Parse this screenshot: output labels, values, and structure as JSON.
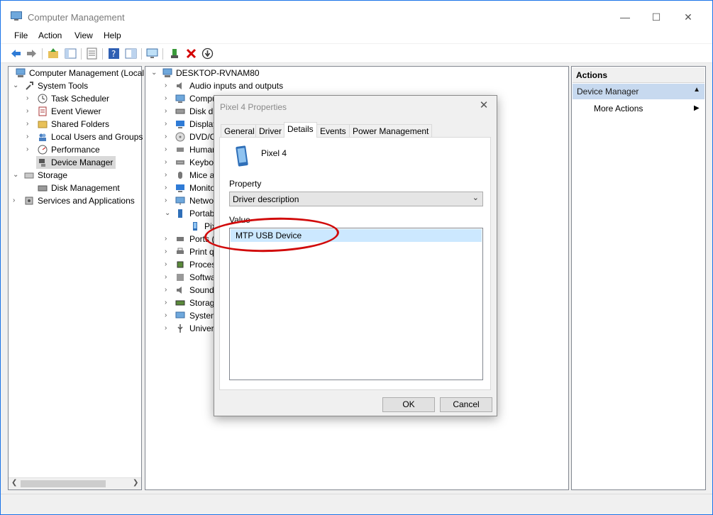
{
  "window": {
    "title": "Computer Management"
  },
  "menu": [
    "File",
    "Action",
    "View",
    "Help"
  ],
  "left_tree": [
    {
      "label": "Computer Management (Local",
      "level": 0,
      "icon": "computer-management-icon",
      "chev": ""
    },
    {
      "label": "System Tools",
      "level": 1,
      "icon": "tools-icon",
      "chev": "⌄"
    },
    {
      "label": "Task Scheduler",
      "level": 2,
      "icon": "clock-icon",
      "chev": "›"
    },
    {
      "label": "Event Viewer",
      "level": 2,
      "icon": "event-viewer-icon",
      "chev": "›"
    },
    {
      "label": "Shared Folders",
      "level": 2,
      "icon": "folder-icon",
      "chev": "›"
    },
    {
      "label": "Local Users and Groups",
      "level": 2,
      "icon": "users-icon",
      "chev": "›"
    },
    {
      "label": "Performance",
      "level": 2,
      "icon": "performance-icon",
      "chev": "›"
    },
    {
      "label": "Device Manager",
      "level": 2,
      "icon": "device-manager-icon",
      "chev": "",
      "selected": true
    },
    {
      "label": "Storage",
      "level": 1,
      "icon": "storage-icon",
      "chev": "⌄"
    },
    {
      "label": "Disk Management",
      "level": 2,
      "icon": "disk-icon",
      "chev": ""
    },
    {
      "label": "Services and Applications",
      "level": 1,
      "icon": "services-icon",
      "chev": "›"
    }
  ],
  "device_tree": {
    "root": "DESKTOP-RVNAM80",
    "items": [
      {
        "label": "Audio inputs and outputs",
        "icon": "speaker-icon",
        "chev": "›"
      },
      {
        "label": "Compu",
        "icon": "computer-icon",
        "chev": "›"
      },
      {
        "label": "Disk dr",
        "icon": "disk-drive-icon",
        "chev": "›"
      },
      {
        "label": "Display",
        "icon": "display-icon",
        "chev": "›"
      },
      {
        "label": "DVD/C",
        "icon": "dvd-icon",
        "chev": "›"
      },
      {
        "label": "Human",
        "icon": "hid-icon",
        "chev": "›"
      },
      {
        "label": "Keyboa",
        "icon": "keyboard-icon",
        "chev": "›"
      },
      {
        "label": "Mice a",
        "icon": "mouse-icon",
        "chev": "›"
      },
      {
        "label": "Monito",
        "icon": "monitor-icon",
        "chev": "›"
      },
      {
        "label": "Netwo",
        "icon": "network-icon",
        "chev": "›"
      },
      {
        "label": "Portab",
        "icon": "portable-device-icon",
        "chev": "⌄"
      },
      {
        "label": "Pix",
        "icon": "phone-icon",
        "chev": "",
        "child": true
      },
      {
        "label": "Ports (",
        "icon": "port-icon",
        "chev": "›"
      },
      {
        "label": "Print q",
        "icon": "printer-icon",
        "chev": "›"
      },
      {
        "label": "Proces",
        "icon": "processor-icon",
        "chev": "›"
      },
      {
        "label": "Softwa",
        "icon": "software-icon",
        "chev": "›"
      },
      {
        "label": "Sound,",
        "icon": "sound-icon",
        "chev": "›"
      },
      {
        "label": "Storag",
        "icon": "storage-controller-icon",
        "chev": "›"
      },
      {
        "label": "System",
        "icon": "system-device-icon",
        "chev": "›"
      },
      {
        "label": "Univers",
        "icon": "usb-icon",
        "chev": "›"
      }
    ]
  },
  "actions": {
    "header": "Actions",
    "section": "Device Manager",
    "more": "More Actions"
  },
  "dialog": {
    "title": "Pixel 4 Properties",
    "tabs": [
      "General",
      "Driver",
      "Details",
      "Events",
      "Power Management"
    ],
    "active_tab": "Details",
    "device_name": "Pixel 4",
    "property_label": "Property",
    "property_value": "Driver description",
    "value_label": "Value",
    "values": [
      "MTP USB Device"
    ],
    "ok": "OK",
    "cancel": "Cancel"
  },
  "colors": {
    "selection": "#cce8ff",
    "actions_section": "#c7d9ef",
    "highlight_ellipse": "#d10a0a"
  }
}
